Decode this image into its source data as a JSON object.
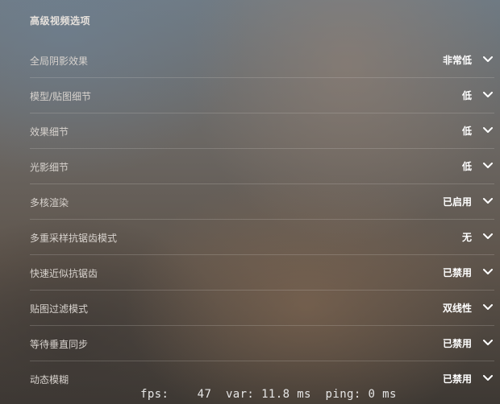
{
  "section": {
    "title": "高级视频选项"
  },
  "settings": [
    {
      "label": "全局阴影效果",
      "value": "非常低"
    },
    {
      "label": "模型/贴图细节",
      "value": "低"
    },
    {
      "label": "效果细节",
      "value": "低"
    },
    {
      "label": "光影细节",
      "value": "低"
    },
    {
      "label": "多核渲染",
      "value": "已启用"
    },
    {
      "label": "多重采样抗锯齿模式",
      "value": "无"
    },
    {
      "label": "快速近似抗锯齿",
      "value": "已禁用"
    },
    {
      "label": "贴图过滤模式",
      "value": "双线性"
    },
    {
      "label": "等待垂直同步",
      "value": "已禁用"
    },
    {
      "label": "动态模糊",
      "value": "已禁用"
    }
  ],
  "overlay": {
    "fps_text": "fps:    47  var: 11.8 ms  ping: 0 ms"
  },
  "icons": {
    "dropdown": "chevron-down-icon"
  },
  "colors": {
    "value_text": "#ffffff",
    "label_text": "#d8d3ce",
    "divider": "rgba(220,215,210,0.22)"
  }
}
